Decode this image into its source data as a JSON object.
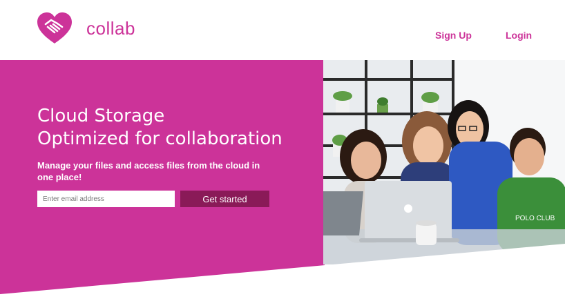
{
  "header": {
    "brand": "collab",
    "nav": {
      "signup_label": "Sign Up",
      "login_label": "Login"
    }
  },
  "hero": {
    "title_line1": "Cloud Storage",
    "title_line2": "Optimized for collaboration",
    "subtitle": "Manage your files and access files from the cloud in one place!",
    "email_placeholder": "Enter email address",
    "email_value": "",
    "cta_label": "Get started",
    "image_icon": "team-working-on-laptop-photo"
  },
  "colors": {
    "brand_pink": "#cc3399",
    "cta_dark": "#8a1a58",
    "background": "#ffffff"
  },
  "icons": {
    "logo": "heart-handshake-icon"
  }
}
